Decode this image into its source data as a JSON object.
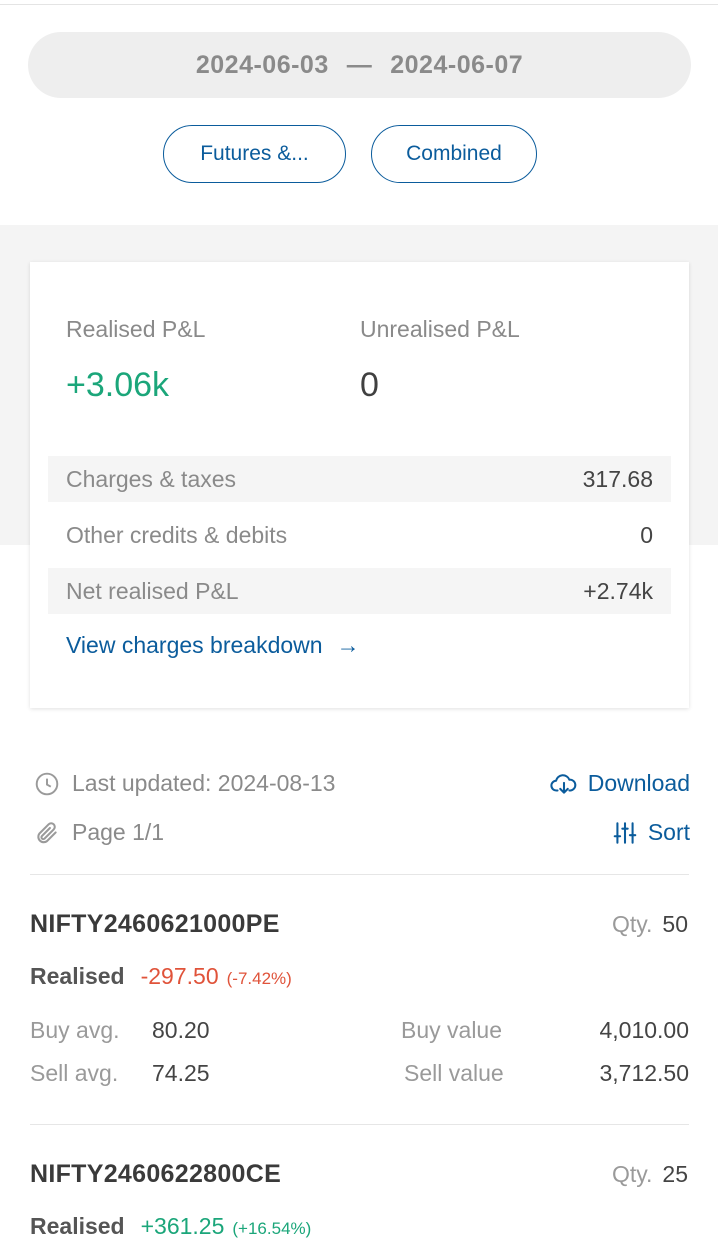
{
  "filters": {
    "date_from": "2024-06-03",
    "date_separator": "—",
    "date_to": "2024-06-07",
    "segment": "Futures &...",
    "view": "Combined"
  },
  "summary": {
    "realised_label": "Realised P&L",
    "realised_value": "+3.06k",
    "unrealised_label": "Unrealised P&L",
    "unrealised_value": "0",
    "charges_label": "Charges & taxes",
    "charges_value": "317.68",
    "other_label": "Other credits & debits",
    "other_value": "0",
    "net_label": "Net realised P&L",
    "net_value": "+2.74k",
    "breakdown_link": "View charges breakdown",
    "breakdown_arrow": "→"
  },
  "meta": {
    "last_updated": "Last updated: 2024-08-13",
    "page": "Page 1/1",
    "download_label": "Download",
    "sort_label": "Sort",
    "icons": [
      "clock-icon",
      "paperclip-icon",
      "download-cloud-icon",
      "sort-sliders-icon"
    ]
  },
  "positions": [
    {
      "symbol": "NIFTY2460621000PE",
      "qty_label": "Qty.",
      "qty": "50",
      "realised_label": "Realised",
      "realised_value": "-297.50",
      "realised_pct": "(-7.42%)",
      "buy_avg_label": "Buy avg.",
      "buy_avg": "80.20",
      "sell_avg_label": "Sell avg.",
      "sell_avg": "74.25",
      "buy_value_label": "Buy value",
      "buy_value": "4,010.00",
      "sell_value_label": "Sell value",
      "sell_value": "3,712.50"
    },
    {
      "symbol": "NIFTY2460622800CE",
      "qty_label": "Qty.",
      "qty": "25",
      "realised_label": "Realised",
      "realised_value": "+361.25",
      "realised_pct": "(+16.54%)"
    }
  ],
  "colors": {
    "accent": "#0b5c9c",
    "profit": "#1ba67a",
    "loss": "#e0533a"
  }
}
